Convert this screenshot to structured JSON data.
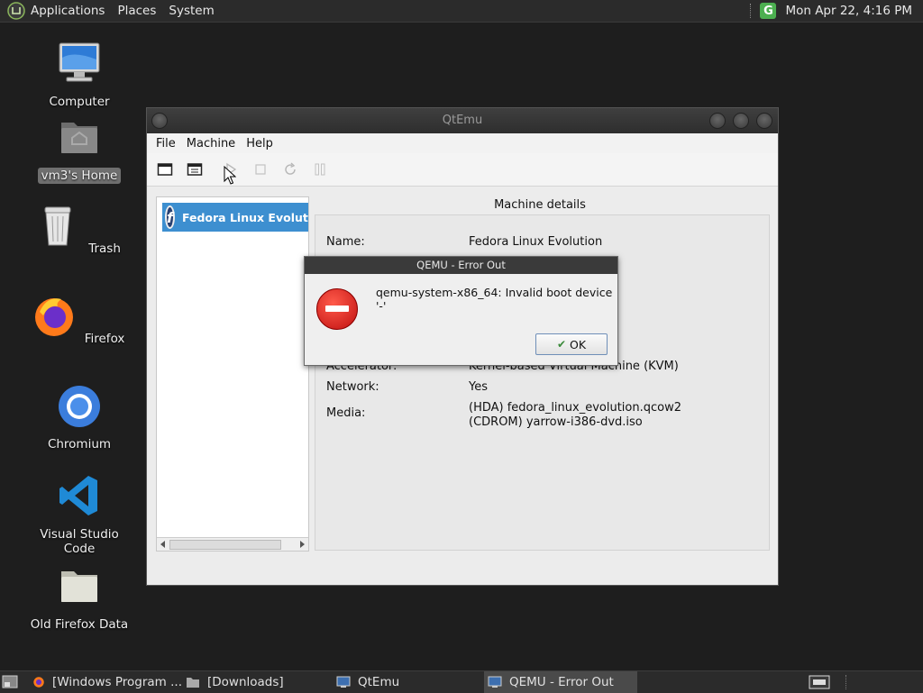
{
  "top_panel": {
    "menus": [
      "Applications",
      "Places",
      "System"
    ],
    "clock": "Mon Apr 22,  4:16 PM",
    "tray_icon": "G"
  },
  "desktop_icons": [
    {
      "label": "Computer",
      "icon": "computer-icon"
    },
    {
      "label": "vm3's Home",
      "icon": "home-folder-icon",
      "selected": true
    },
    {
      "label": "Trash",
      "icon": "trash-icon"
    },
    {
      "label": "Firefox",
      "icon": "firefox-icon"
    },
    {
      "label": "Chromium",
      "icon": "chromium-icon"
    },
    {
      "label": "Visual Studio Code",
      "icon": "vscode-icon"
    },
    {
      "label": "Old Firefox Data",
      "icon": "folder-icon"
    }
  ],
  "qtemu": {
    "title": "QtEmu",
    "menus": [
      "File",
      "Machine",
      "Help"
    ],
    "machine_item": "Fedora Linux Evolution",
    "details_title": "Machine details",
    "details": {
      "name_label": "Name:",
      "name_value": "Fedora Linux Evolution",
      "accel_label": "Accelerator:",
      "accel_value": "Kernel-based Virtual Machine (KVM)",
      "network_label": "Network:",
      "network_value": "Yes",
      "media_label": "Media:",
      "media_value_1": "(HDA) fedora_linux_evolution.qcow2",
      "media_value_2": "(CDROM) yarrow-i386-dvd.iso"
    }
  },
  "error_dialog": {
    "title": "QEMU - Error Out",
    "message": "qemu-system-x86_64: Invalid boot device '-'",
    "ok_label": "OK"
  },
  "taskbar": {
    "tasks": [
      "[Windows Program ...",
      "[Downloads]",
      "QtEmu",
      "QEMU - Error Out"
    ]
  },
  "colors": {
    "selection": "#3d8fd0",
    "panel": "#2b2b2b",
    "desktop": "#1e1e1e"
  }
}
